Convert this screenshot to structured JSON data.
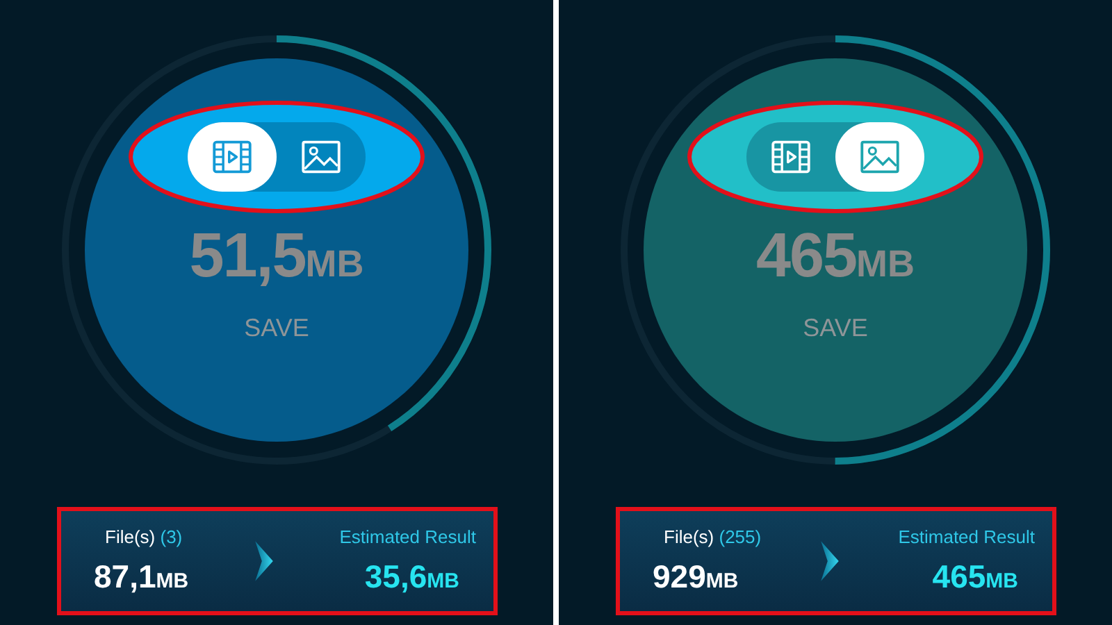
{
  "panels": [
    {
      "toggle": [
        {
          "kind": "video",
          "selected": true
        },
        {
          "kind": "image",
          "selected": false
        }
      ],
      "ring": {
        "level": 0.41
      },
      "saved": {
        "value": "51,5",
        "unit": "MB"
      },
      "save_label": "SAVE",
      "summary": {
        "files_label": "File(s)",
        "files_count": "(3)",
        "source": {
          "value": "87,1",
          "unit": "MB"
        },
        "result_label": "Estimated Result",
        "result": {
          "value": "35,6",
          "unit": "MB"
        }
      }
    },
    {
      "toggle": [
        {
          "kind": "video",
          "selected": false
        },
        {
          "kind": "image",
          "selected": true
        }
      ],
      "ring": {
        "level": 0.5
      },
      "saved": {
        "value": "465",
        "unit": "MB"
      },
      "save_label": "SAVE",
      "summary": {
        "files_label": "File(s)",
        "files_count": "(255)",
        "source": {
          "value": "929",
          "unit": "MB"
        },
        "result_label": "Estimated Result",
        "result": {
          "value": "465",
          "unit": "MB"
        }
      }
    }
  ]
}
